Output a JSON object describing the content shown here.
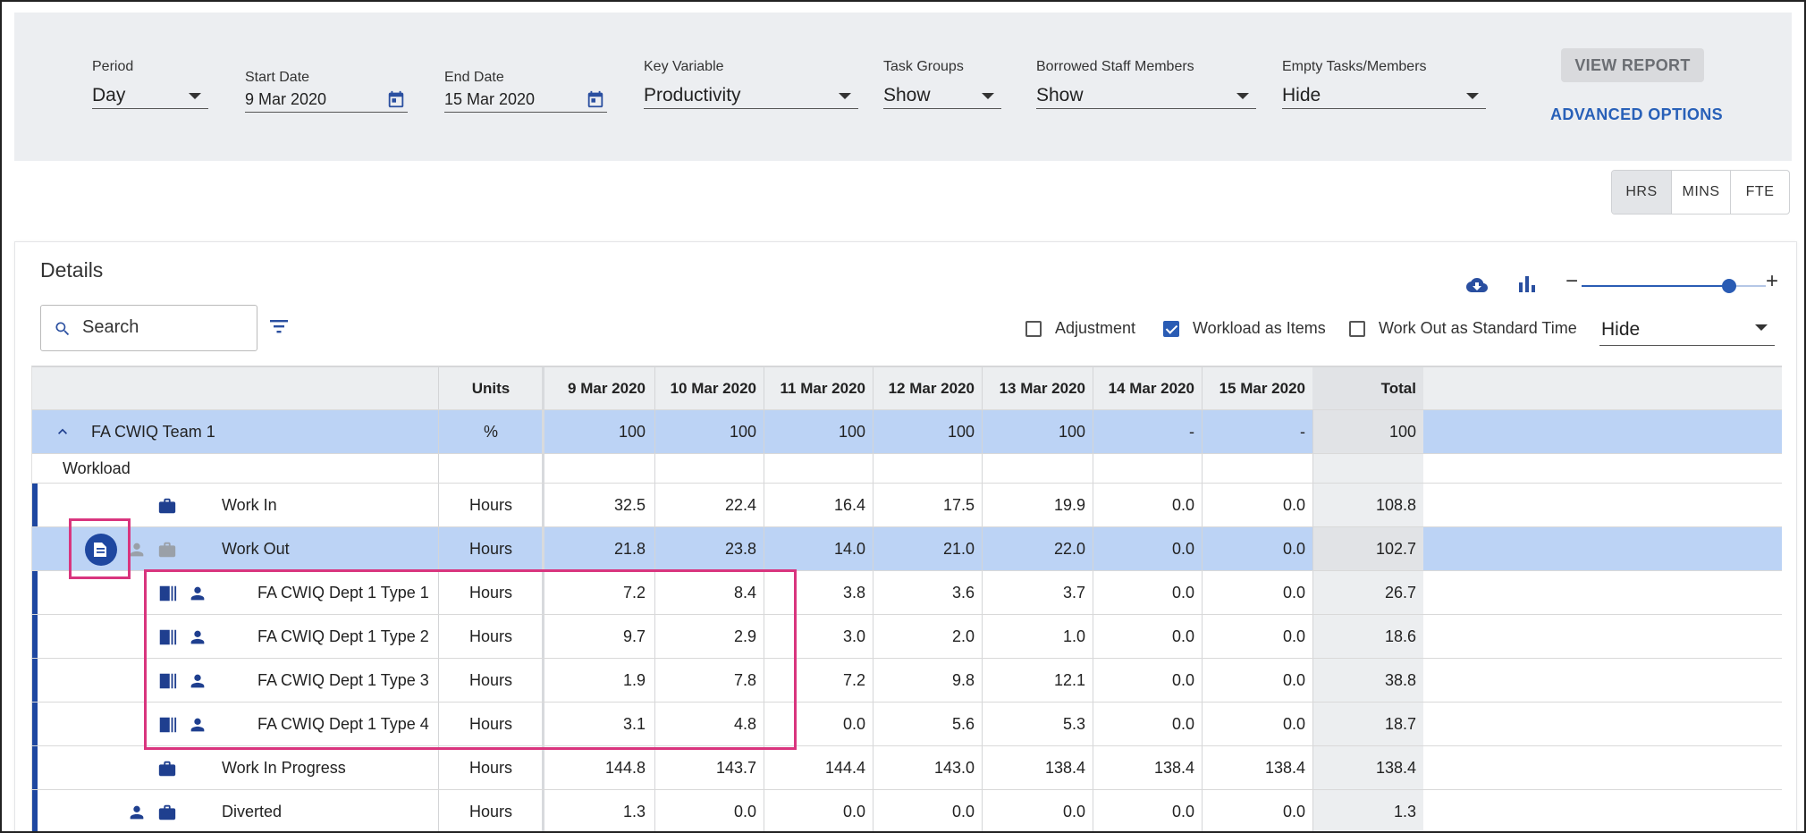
{
  "filters": {
    "period": {
      "label": "Period",
      "value": "Day"
    },
    "start_date": {
      "label": "Start Date",
      "value": "9 Mar 2020"
    },
    "end_date": {
      "label": "End Date",
      "value": "15 Mar 2020"
    },
    "key_variable": {
      "label": "Key Variable",
      "value": "Productivity"
    },
    "task_groups": {
      "label": "Task Groups",
      "value": "Show"
    },
    "borrowed_staff": {
      "label": "Borrowed Staff Members",
      "value": "Show"
    },
    "empty_tasks": {
      "label": "Empty Tasks/Members",
      "value": "Hide"
    },
    "view_report": "VIEW REPORT",
    "advanced_options": "ADVANCED OPTIONS"
  },
  "unit_toggle": {
    "hrs": "HRS",
    "mins": "MINS",
    "fte": "FTE",
    "active": "HRS"
  },
  "details": {
    "title": "Details",
    "search_placeholder": "Search",
    "zoom_level": 0.8,
    "checkboxes": {
      "adjustment": {
        "label": "Adjustment",
        "checked": false
      },
      "workload_items": {
        "label": "Workload as Items",
        "checked": true
      },
      "work_out_std": {
        "label": "Work Out as Standard Time",
        "checked": false
      }
    },
    "hide_select": "Hide"
  },
  "grid": {
    "headers": {
      "units": "Units",
      "d1": "9 Mar 2020",
      "d2": "10 Mar 2020",
      "d3": "11 Mar 2020",
      "d4": "12 Mar 2020",
      "d5": "13 Mar 2020",
      "d6": "14 Mar 2020",
      "d7": "15 Mar 2020",
      "total": "Total"
    },
    "team": {
      "name": "FA CWIQ Team 1",
      "units": "%",
      "values": [
        "100",
        "100",
        "100",
        "100",
        "100",
        "-",
        "-",
        "100"
      ]
    },
    "section": "Workload",
    "rows": [
      {
        "name": "Work In",
        "units": "Hours",
        "values": [
          "32.5",
          "22.4",
          "16.4",
          "17.5",
          "19.9",
          "0.0",
          "0.0",
          "108.8"
        ]
      },
      {
        "name": "Work Out",
        "units": "Hours",
        "values": [
          "21.8",
          "23.8",
          "14.0",
          "21.0",
          "22.0",
          "0.0",
          "0.0",
          "102.7"
        ]
      },
      {
        "name": "FA CWIQ Dept 1 Type 1",
        "units": "Hours",
        "values": [
          "7.2",
          "8.4",
          "3.8",
          "3.6",
          "3.7",
          "0.0",
          "0.0",
          "26.7"
        ]
      },
      {
        "name": "FA CWIQ Dept 1 Type 2",
        "units": "Hours",
        "values": [
          "9.7",
          "2.9",
          "3.0",
          "2.0",
          "1.0",
          "0.0",
          "0.0",
          "18.6"
        ]
      },
      {
        "name": "FA CWIQ Dept 1 Type 3",
        "units": "Hours",
        "values": [
          "1.9",
          "7.8",
          "7.2",
          "9.8",
          "12.1",
          "0.0",
          "0.0",
          "38.8"
        ]
      },
      {
        "name": "FA CWIQ Dept 1 Type 4",
        "units": "Hours",
        "values": [
          "3.1",
          "4.8",
          "0.0",
          "5.6",
          "5.3",
          "0.0",
          "0.0",
          "18.7"
        ]
      },
      {
        "name": "Work In Progress",
        "units": "Hours",
        "values": [
          "144.8",
          "143.7",
          "144.4",
          "143.0",
          "138.4",
          "138.4",
          "138.4",
          "138.4"
        ]
      },
      {
        "name": "Diverted",
        "units": "Hours",
        "values": [
          "1.3",
          "0.0",
          "0.0",
          "0.0",
          "0.0",
          "0.0",
          "0.0",
          "1.3"
        ]
      }
    ]
  }
}
